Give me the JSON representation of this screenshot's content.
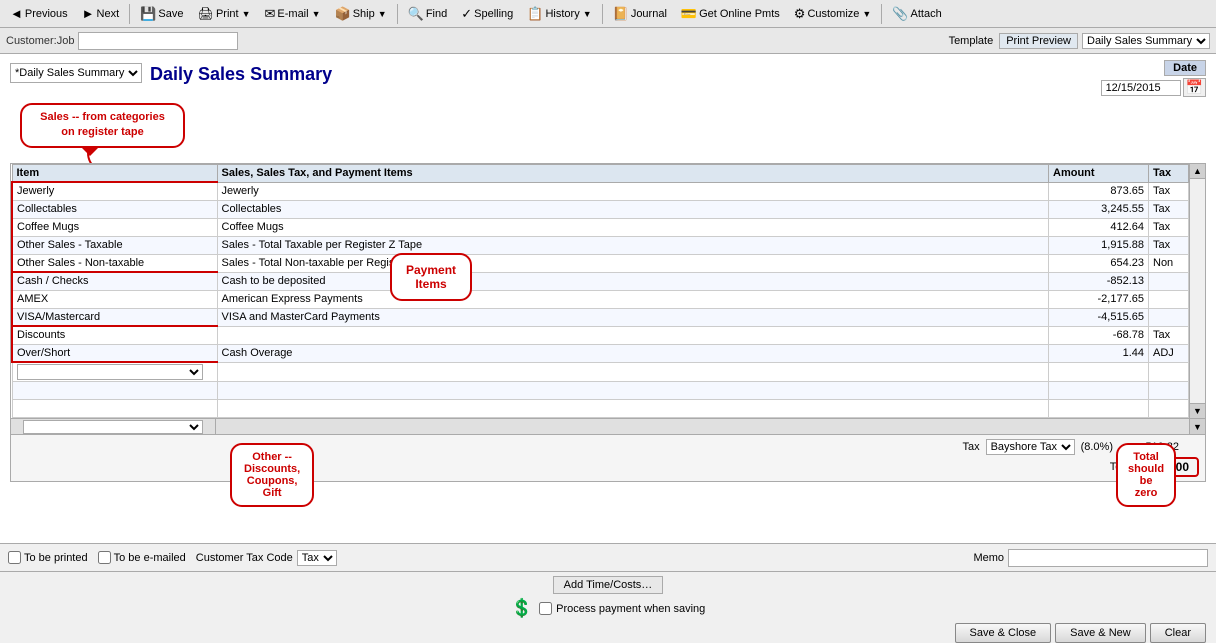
{
  "toolbar": {
    "buttons": [
      {
        "label": "Previous",
        "icon": "◄",
        "has_arrow": false
      },
      {
        "label": "Next",
        "icon": "►",
        "has_arrow": false
      },
      {
        "label": "Save",
        "icon": "💾",
        "has_arrow": false
      },
      {
        "label": "Print",
        "icon": "🖨",
        "has_arrow": true
      },
      {
        "label": "E-mail",
        "icon": "✉",
        "has_arrow": true
      },
      {
        "label": "Ship",
        "icon": "📦",
        "has_arrow": true
      },
      {
        "label": "Find",
        "icon": "🔍",
        "has_arrow": false
      },
      {
        "label": "Spelling",
        "icon": "✓",
        "has_arrow": false
      },
      {
        "label": "History",
        "icon": "📋",
        "has_arrow": true
      },
      {
        "label": "Journal",
        "icon": "📔",
        "has_arrow": false
      },
      {
        "label": "Get Online Pmts",
        "icon": "💳",
        "has_arrow": false
      },
      {
        "label": "Customize",
        "icon": "⚙",
        "has_arrow": true
      },
      {
        "label": "Attach",
        "icon": "📎",
        "has_arrow": false
      }
    ]
  },
  "customer": {
    "label": "Customer:Job",
    "value": ""
  },
  "template": {
    "label": "Template",
    "print_preview": "Print Preview",
    "selected": "Daily Sales Summary",
    "options": [
      "Daily Sales Summary"
    ]
  },
  "form": {
    "title": "Daily Sales Summary",
    "dropdown_selected": "*Daily Sales Summary",
    "date_label": "Date",
    "date_value": "12/15/2015"
  },
  "callouts": {
    "sales": "Sales --  from categories\non register tape",
    "payment": "Payment Items",
    "other": "Other -- Discounts,\nCoupons, Gift",
    "total_zero": "Total should be\nzero"
  },
  "table": {
    "headers": [
      "Item",
      "Sales, Sales Tax, and Payment Items",
      "Amount",
      "Tax"
    ],
    "rows": [
      {
        "item": "Jewerly",
        "description": "Jewerly",
        "amount": "873.65",
        "tax": "Tax",
        "group": "sales"
      },
      {
        "item": "Collectables",
        "description": "Collectables",
        "amount": "3,245.55",
        "tax": "Tax",
        "group": "sales"
      },
      {
        "item": "Coffee Mugs",
        "description": "Coffee Mugs",
        "amount": "412.64",
        "tax": "Tax",
        "group": "sales"
      },
      {
        "item": "Other Sales - Taxable",
        "description": "Sales - Total Taxable per Register Z Tape",
        "amount": "1,915.88",
        "tax": "Tax",
        "group": "sales"
      },
      {
        "item": "Other Sales - Non-taxable",
        "description": "Sales - Total Non-taxable per Register Z Tape",
        "amount": "654.23",
        "tax": "Non",
        "group": "sales"
      },
      {
        "item": "Cash / Checks",
        "description": "Cash to be deposited",
        "amount": "-852.13",
        "tax": "",
        "group": "payment"
      },
      {
        "item": "AMEX",
        "description": "American Express Payments",
        "amount": "-2,177.65",
        "tax": "",
        "group": "payment"
      },
      {
        "item": "VISA/Mastercard",
        "description": "VISA and MasterCard Payments",
        "amount": "-4,515.65",
        "tax": "",
        "group": "payment"
      },
      {
        "item": "Discounts",
        "description": "",
        "amount": "-68.78",
        "tax": "Tax",
        "group": "other"
      },
      {
        "item": "Over/Short",
        "description": "Cash Overage",
        "amount": "1.44",
        "tax": "ADJ",
        "group": "other"
      },
      {
        "item": "",
        "description": "",
        "amount": "",
        "tax": "",
        "group": "empty"
      },
      {
        "item": "",
        "description": "",
        "amount": "",
        "tax": "",
        "group": "empty"
      },
      {
        "item": "",
        "description": "",
        "amount": "",
        "tax": "",
        "group": "empty"
      }
    ]
  },
  "tax_row": {
    "label": "Tax",
    "dropdown": "Bayshore Tax",
    "rate": "(8.0%)",
    "amount": "510.82"
  },
  "total_row": {
    "label": "Total",
    "amount": "0.00"
  },
  "bottom": {
    "to_be_printed": "To be printed",
    "to_be_emailed": "To be e-mailed",
    "tax_code_label": "Customer Tax Code",
    "tax_code_value": "Tax",
    "memo_label": "Memo"
  },
  "actions": {
    "add_time_costs": "Add Time/Costs…",
    "process_payment_label": "Process  payment when saving",
    "save_close": "Save & Close",
    "save_new": "Save & New",
    "clear": "Clear"
  }
}
